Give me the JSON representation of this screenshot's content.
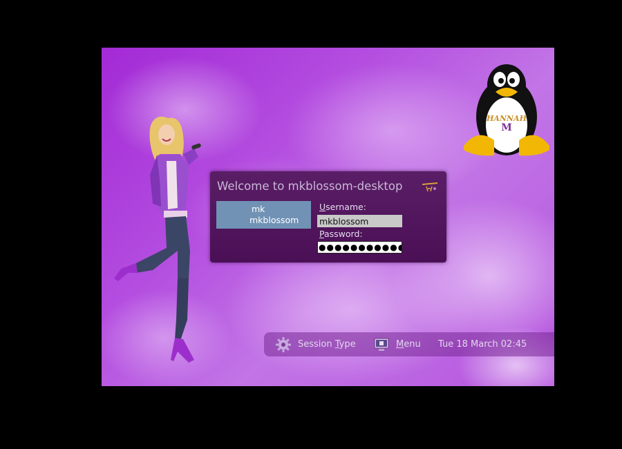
{
  "dialog": {
    "title": "Welcome to mkblossom-desktop",
    "users": [
      {
        "first": "mk",
        "second": "mkblossom"
      }
    ],
    "username_label_accel": "U",
    "username_label_rest": "sername:",
    "username_value": "mkblossom",
    "password_label_accel": "P",
    "password_label_rest": "assword:",
    "password_value": "●●●●●●●●●●●●"
  },
  "panel": {
    "session_pre": "Session ",
    "session_accel": "T",
    "session_post": "ype",
    "menu_accel": "M",
    "menu_rest": "enu",
    "clock": "Tue 18 March 02:45"
  },
  "colors": {
    "background": "#b44ee0",
    "dialog": "#4a0f55",
    "user_selection": "#7192b5"
  },
  "icons": {
    "session": "gear-icon",
    "menu": "monitor-icon"
  }
}
